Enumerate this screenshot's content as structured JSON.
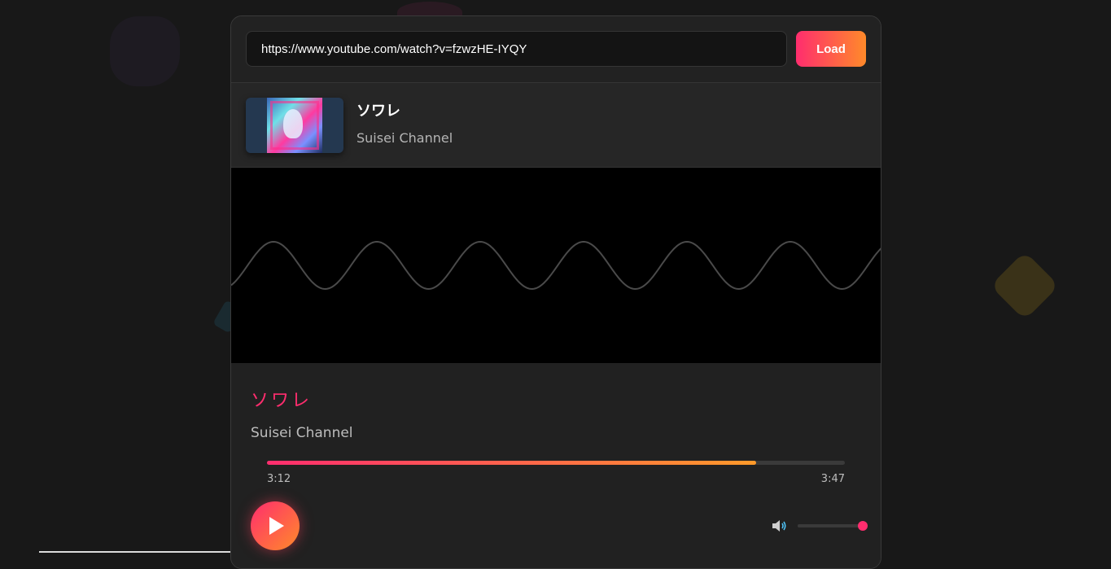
{
  "url_bar": {
    "url_value": "https://www.youtube.com/watch?v=fzwzHE-IYQY",
    "load_label": "Load"
  },
  "track": {
    "title": "ソワレ",
    "channel": "Suisei Channel"
  },
  "player": {
    "title": "ソワレ",
    "channel": "Suisei Channel",
    "current_time": "3:12",
    "duration": "3:47",
    "progress_fraction": 0.846,
    "volume_fraction": 1.0,
    "state": "paused"
  },
  "colors": {
    "accent_pink": "#ff2d6e",
    "accent_orange": "#ff8a2a",
    "wave_stroke": "#4a4a4a"
  },
  "icons": {
    "play": "play-icon",
    "volume": "speaker-icon"
  }
}
